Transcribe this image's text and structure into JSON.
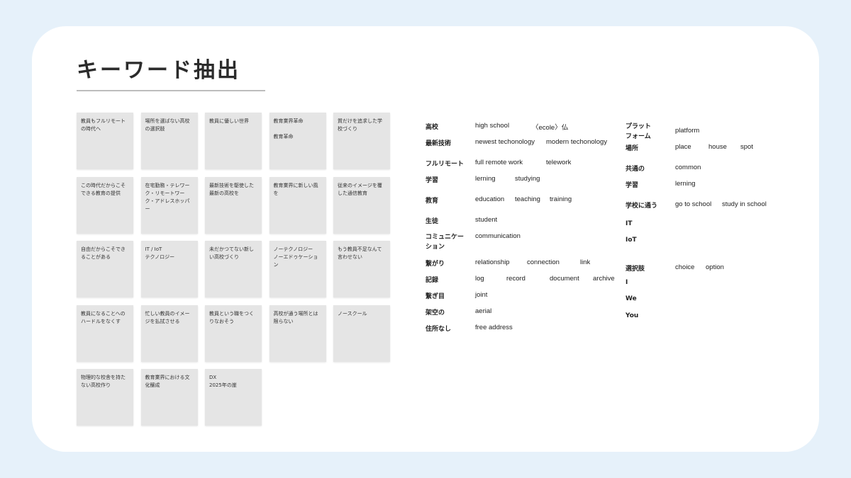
{
  "title": "キーワード抽出",
  "notes": [
    "教員もフルリモートの時代へ",
    "場所を選ばない高校の選択肢",
    "教員に優しい世界",
    "教育業界革命\n\n教育革命",
    "質だけを追求した学校づくり",
    "この時代だからこそできる教育の提供",
    "在宅勤務・テレワーク・リモートワーク・アドレスホッパー",
    "最新技術を駆使した最新の高校を",
    "教育業界に新しい風を",
    "従来のイメージを覆した通信教育",
    "自由だからこそできることがある",
    "IT / IoT\nテクノロジー",
    "未だかつてない新しい高校づくり",
    "ノーテクノロジー\nノーエドゥケーション",
    "もう教員不足なんて言わせない",
    "教員になることへのハードルをなくす",
    "忙しい教員のイメージを払拭させる",
    "教員という職をつくりなおそう",
    "高校が通う場所とは限らない",
    "ノースクール",
    "物理的な校舎を持たない高校作り",
    "教育業界における文化醸成",
    "DX\n2025年の崖"
  ],
  "keywords_left": [
    {
      "term": "高校",
      "words": [
        "high school",
        "〈ecole〉仏"
      ]
    },
    {
      "term": "最新技術",
      "words": [
        "newest techonology",
        "modern techonology"
      ]
    },
    {
      "term": "フルリモート",
      "words": [
        "full remote work",
        "telework"
      ]
    },
    {
      "term": "学習",
      "words": [
        "lerning",
        "studying"
      ]
    },
    {
      "term": "教育",
      "words": [
        "education",
        "teaching",
        "training"
      ]
    },
    {
      "term": "生徒",
      "words": [
        "student"
      ]
    },
    {
      "term": "コミュニケーション",
      "words": [
        "communication"
      ]
    },
    {
      "term": "繋がり",
      "words": [
        "relationship",
        "connection",
        "link"
      ]
    },
    {
      "term": "記録",
      "words": [
        "log",
        "record",
        "document",
        "archive"
      ]
    },
    {
      "term": "繋ぎ目",
      "words": [
        "joint"
      ]
    },
    {
      "term": "架空の",
      "words": [
        "aerial"
      ]
    },
    {
      "term": "住所なし",
      "words": [
        "free address"
      ]
    }
  ],
  "keywords_right": [
    {
      "term": "プラットフォーム",
      "words": [
        "platform"
      ]
    },
    {
      "term": "場所",
      "words": [
        "place",
        "house",
        "spot"
      ]
    },
    {
      "term": "共通の",
      "words": [
        "common"
      ]
    },
    {
      "term": "学習",
      "words": [
        "lerning"
      ]
    },
    {
      "term": "学校に通う",
      "words": [
        "go to school",
        "study in school"
      ]
    },
    {
      "term": "IT",
      "words": []
    },
    {
      "term": "IoT",
      "words": []
    },
    {
      "term": "選択肢",
      "words": [
        "choice",
        "option"
      ]
    },
    {
      "term": "I",
      "words": []
    },
    {
      "term": "We",
      "words": []
    },
    {
      "term": "You",
      "words": []
    }
  ]
}
